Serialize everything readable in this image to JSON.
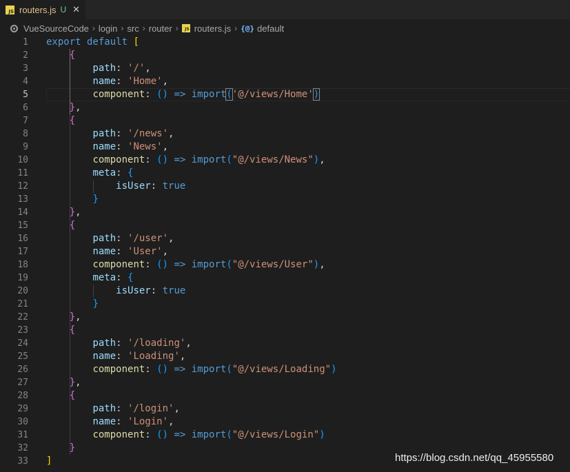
{
  "tab": {
    "icon": "js-file-icon",
    "icon_text": "JS",
    "title": "routers.js",
    "status": "U",
    "close": "✕"
  },
  "breadcrumb": {
    "items": [
      "VueSourceCode",
      "login",
      "src",
      "router",
      "routers.js",
      "default"
    ],
    "symbol_glyph": "{@}"
  },
  "editor": {
    "active_line": 5,
    "lines": [
      [
        {
          "t": "export default",
          "c": "storage"
        },
        {
          "t": " "
        },
        {
          "t": "[",
          "c": "br1"
        }
      ],
      [
        {
          "t": "    "
        },
        {
          "t": "{",
          "c": "br2"
        }
      ],
      [
        {
          "t": "        "
        },
        {
          "t": "path",
          "c": "prop"
        },
        {
          "t": ": "
        },
        {
          "t": "'/'",
          "c": "str"
        },
        {
          "t": ","
        }
      ],
      [
        {
          "t": "        "
        },
        {
          "t": "name",
          "c": "prop"
        },
        {
          "t": ": "
        },
        {
          "t": "'Home'",
          "c": "str"
        },
        {
          "t": ","
        }
      ],
      [
        {
          "t": "        "
        },
        {
          "t": "component",
          "c": "prop-fn"
        },
        {
          "t": ": "
        },
        {
          "t": "()",
          "c": "br3"
        },
        {
          "t": " "
        },
        {
          "t": "=>",
          "c": "arrow"
        },
        {
          "t": " "
        },
        {
          "t": "import",
          "c": "import"
        },
        {
          "t": "(",
          "c": "br3",
          "m": true
        },
        {
          "t": "'@/views/Home'",
          "c": "str"
        },
        {
          "t": ")",
          "c": "br3",
          "m": true
        }
      ],
      [
        {
          "t": "    "
        },
        {
          "t": "}",
          "c": "br2"
        },
        {
          "t": ","
        }
      ],
      [
        {
          "t": "    "
        },
        {
          "t": "{",
          "c": "br2"
        }
      ],
      [
        {
          "t": "        "
        },
        {
          "t": "path",
          "c": "prop"
        },
        {
          "t": ": "
        },
        {
          "t": "'/news'",
          "c": "str"
        },
        {
          "t": ","
        }
      ],
      [
        {
          "t": "        "
        },
        {
          "t": "name",
          "c": "prop"
        },
        {
          "t": ": "
        },
        {
          "t": "'News'",
          "c": "str"
        },
        {
          "t": ","
        }
      ],
      [
        {
          "t": "        "
        },
        {
          "t": "component",
          "c": "prop-fn"
        },
        {
          "t": ": "
        },
        {
          "t": "()",
          "c": "br3"
        },
        {
          "t": " "
        },
        {
          "t": "=>",
          "c": "arrow"
        },
        {
          "t": " "
        },
        {
          "t": "import",
          "c": "import"
        },
        {
          "t": "(",
          "c": "br3"
        },
        {
          "t": "\"@/views/News\"",
          "c": "str"
        },
        {
          "t": ")",
          "c": "br3"
        },
        {
          "t": ","
        }
      ],
      [
        {
          "t": "        "
        },
        {
          "t": "meta",
          "c": "prop"
        },
        {
          "t": ": "
        },
        {
          "t": "{",
          "c": "br3"
        }
      ],
      [
        {
          "t": "            "
        },
        {
          "t": "isUser",
          "c": "prop"
        },
        {
          "t": ": "
        },
        {
          "t": "true",
          "c": "bool"
        }
      ],
      [
        {
          "t": "        "
        },
        {
          "t": "}",
          "c": "br3"
        }
      ],
      [
        {
          "t": "    "
        },
        {
          "t": "}",
          "c": "br2"
        },
        {
          "t": ","
        }
      ],
      [
        {
          "t": "    "
        },
        {
          "t": "{",
          "c": "br2"
        }
      ],
      [
        {
          "t": "        "
        },
        {
          "t": "path",
          "c": "prop"
        },
        {
          "t": ": "
        },
        {
          "t": "'/user'",
          "c": "str"
        },
        {
          "t": ","
        }
      ],
      [
        {
          "t": "        "
        },
        {
          "t": "name",
          "c": "prop"
        },
        {
          "t": ": "
        },
        {
          "t": "'User'",
          "c": "str"
        },
        {
          "t": ","
        }
      ],
      [
        {
          "t": "        "
        },
        {
          "t": "component",
          "c": "prop-fn"
        },
        {
          "t": ": "
        },
        {
          "t": "()",
          "c": "br3"
        },
        {
          "t": " "
        },
        {
          "t": "=>",
          "c": "arrow"
        },
        {
          "t": " "
        },
        {
          "t": "import",
          "c": "import"
        },
        {
          "t": "(",
          "c": "br3"
        },
        {
          "t": "\"@/views/User\"",
          "c": "str"
        },
        {
          "t": ")",
          "c": "br3"
        },
        {
          "t": ","
        }
      ],
      [
        {
          "t": "        "
        },
        {
          "t": "meta",
          "c": "prop"
        },
        {
          "t": ": "
        },
        {
          "t": "{",
          "c": "br3"
        }
      ],
      [
        {
          "t": "            "
        },
        {
          "t": "isUser",
          "c": "prop"
        },
        {
          "t": ": "
        },
        {
          "t": "true",
          "c": "bool"
        }
      ],
      [
        {
          "t": "        "
        },
        {
          "t": "}",
          "c": "br3"
        }
      ],
      [
        {
          "t": "    "
        },
        {
          "t": "}",
          "c": "br2"
        },
        {
          "t": ","
        }
      ],
      [
        {
          "t": "    "
        },
        {
          "t": "{",
          "c": "br2"
        }
      ],
      [
        {
          "t": "        "
        },
        {
          "t": "path",
          "c": "prop"
        },
        {
          "t": ": "
        },
        {
          "t": "'/loading'",
          "c": "str"
        },
        {
          "t": ","
        }
      ],
      [
        {
          "t": "        "
        },
        {
          "t": "name",
          "c": "prop"
        },
        {
          "t": ": "
        },
        {
          "t": "'Loading'",
          "c": "str"
        },
        {
          "t": ","
        }
      ],
      [
        {
          "t": "        "
        },
        {
          "t": "component",
          "c": "prop-fn"
        },
        {
          "t": ": "
        },
        {
          "t": "()",
          "c": "br3"
        },
        {
          "t": " "
        },
        {
          "t": "=>",
          "c": "arrow"
        },
        {
          "t": " "
        },
        {
          "t": "import",
          "c": "import"
        },
        {
          "t": "(",
          "c": "br3"
        },
        {
          "t": "\"@/views/Loading\"",
          "c": "str"
        },
        {
          "t": ")",
          "c": "br3"
        }
      ],
      [
        {
          "t": "    "
        },
        {
          "t": "}",
          "c": "br2"
        },
        {
          "t": ","
        }
      ],
      [
        {
          "t": "    "
        },
        {
          "t": "{",
          "c": "br2"
        }
      ],
      [
        {
          "t": "        "
        },
        {
          "t": "path",
          "c": "prop"
        },
        {
          "t": ": "
        },
        {
          "t": "'/login'",
          "c": "str"
        },
        {
          "t": ","
        }
      ],
      [
        {
          "t": "        "
        },
        {
          "t": "name",
          "c": "prop"
        },
        {
          "t": ": "
        },
        {
          "t": "'Login'",
          "c": "str"
        },
        {
          "t": ","
        }
      ],
      [
        {
          "t": "        "
        },
        {
          "t": "component",
          "c": "prop-fn"
        },
        {
          "t": ": "
        },
        {
          "t": "()",
          "c": "br3"
        },
        {
          "t": " "
        },
        {
          "t": "=>",
          "c": "arrow"
        },
        {
          "t": " "
        },
        {
          "t": "import",
          "c": "import"
        },
        {
          "t": "(",
          "c": "br3"
        },
        {
          "t": "\"@/views/Login\"",
          "c": "str"
        },
        {
          "t": ")",
          "c": "br3"
        }
      ],
      [
        {
          "t": "    "
        },
        {
          "t": "}",
          "c": "br2"
        }
      ],
      [
        {
          "t": "]",
          "c": "br1"
        }
      ]
    ]
  },
  "watermark": "https://blog.csdn.net/qq_45955580",
  "colors": {
    "background": "#1e1e1e",
    "tab_title": "#e2c08d",
    "untracked": "#73c991",
    "keyword": "#569cd6",
    "property": "#9cdcfe",
    "string": "#ce9178",
    "bracket_level1": "#ffd700",
    "bracket_level2": "#da70d6",
    "bracket_level3": "#179fff"
  }
}
